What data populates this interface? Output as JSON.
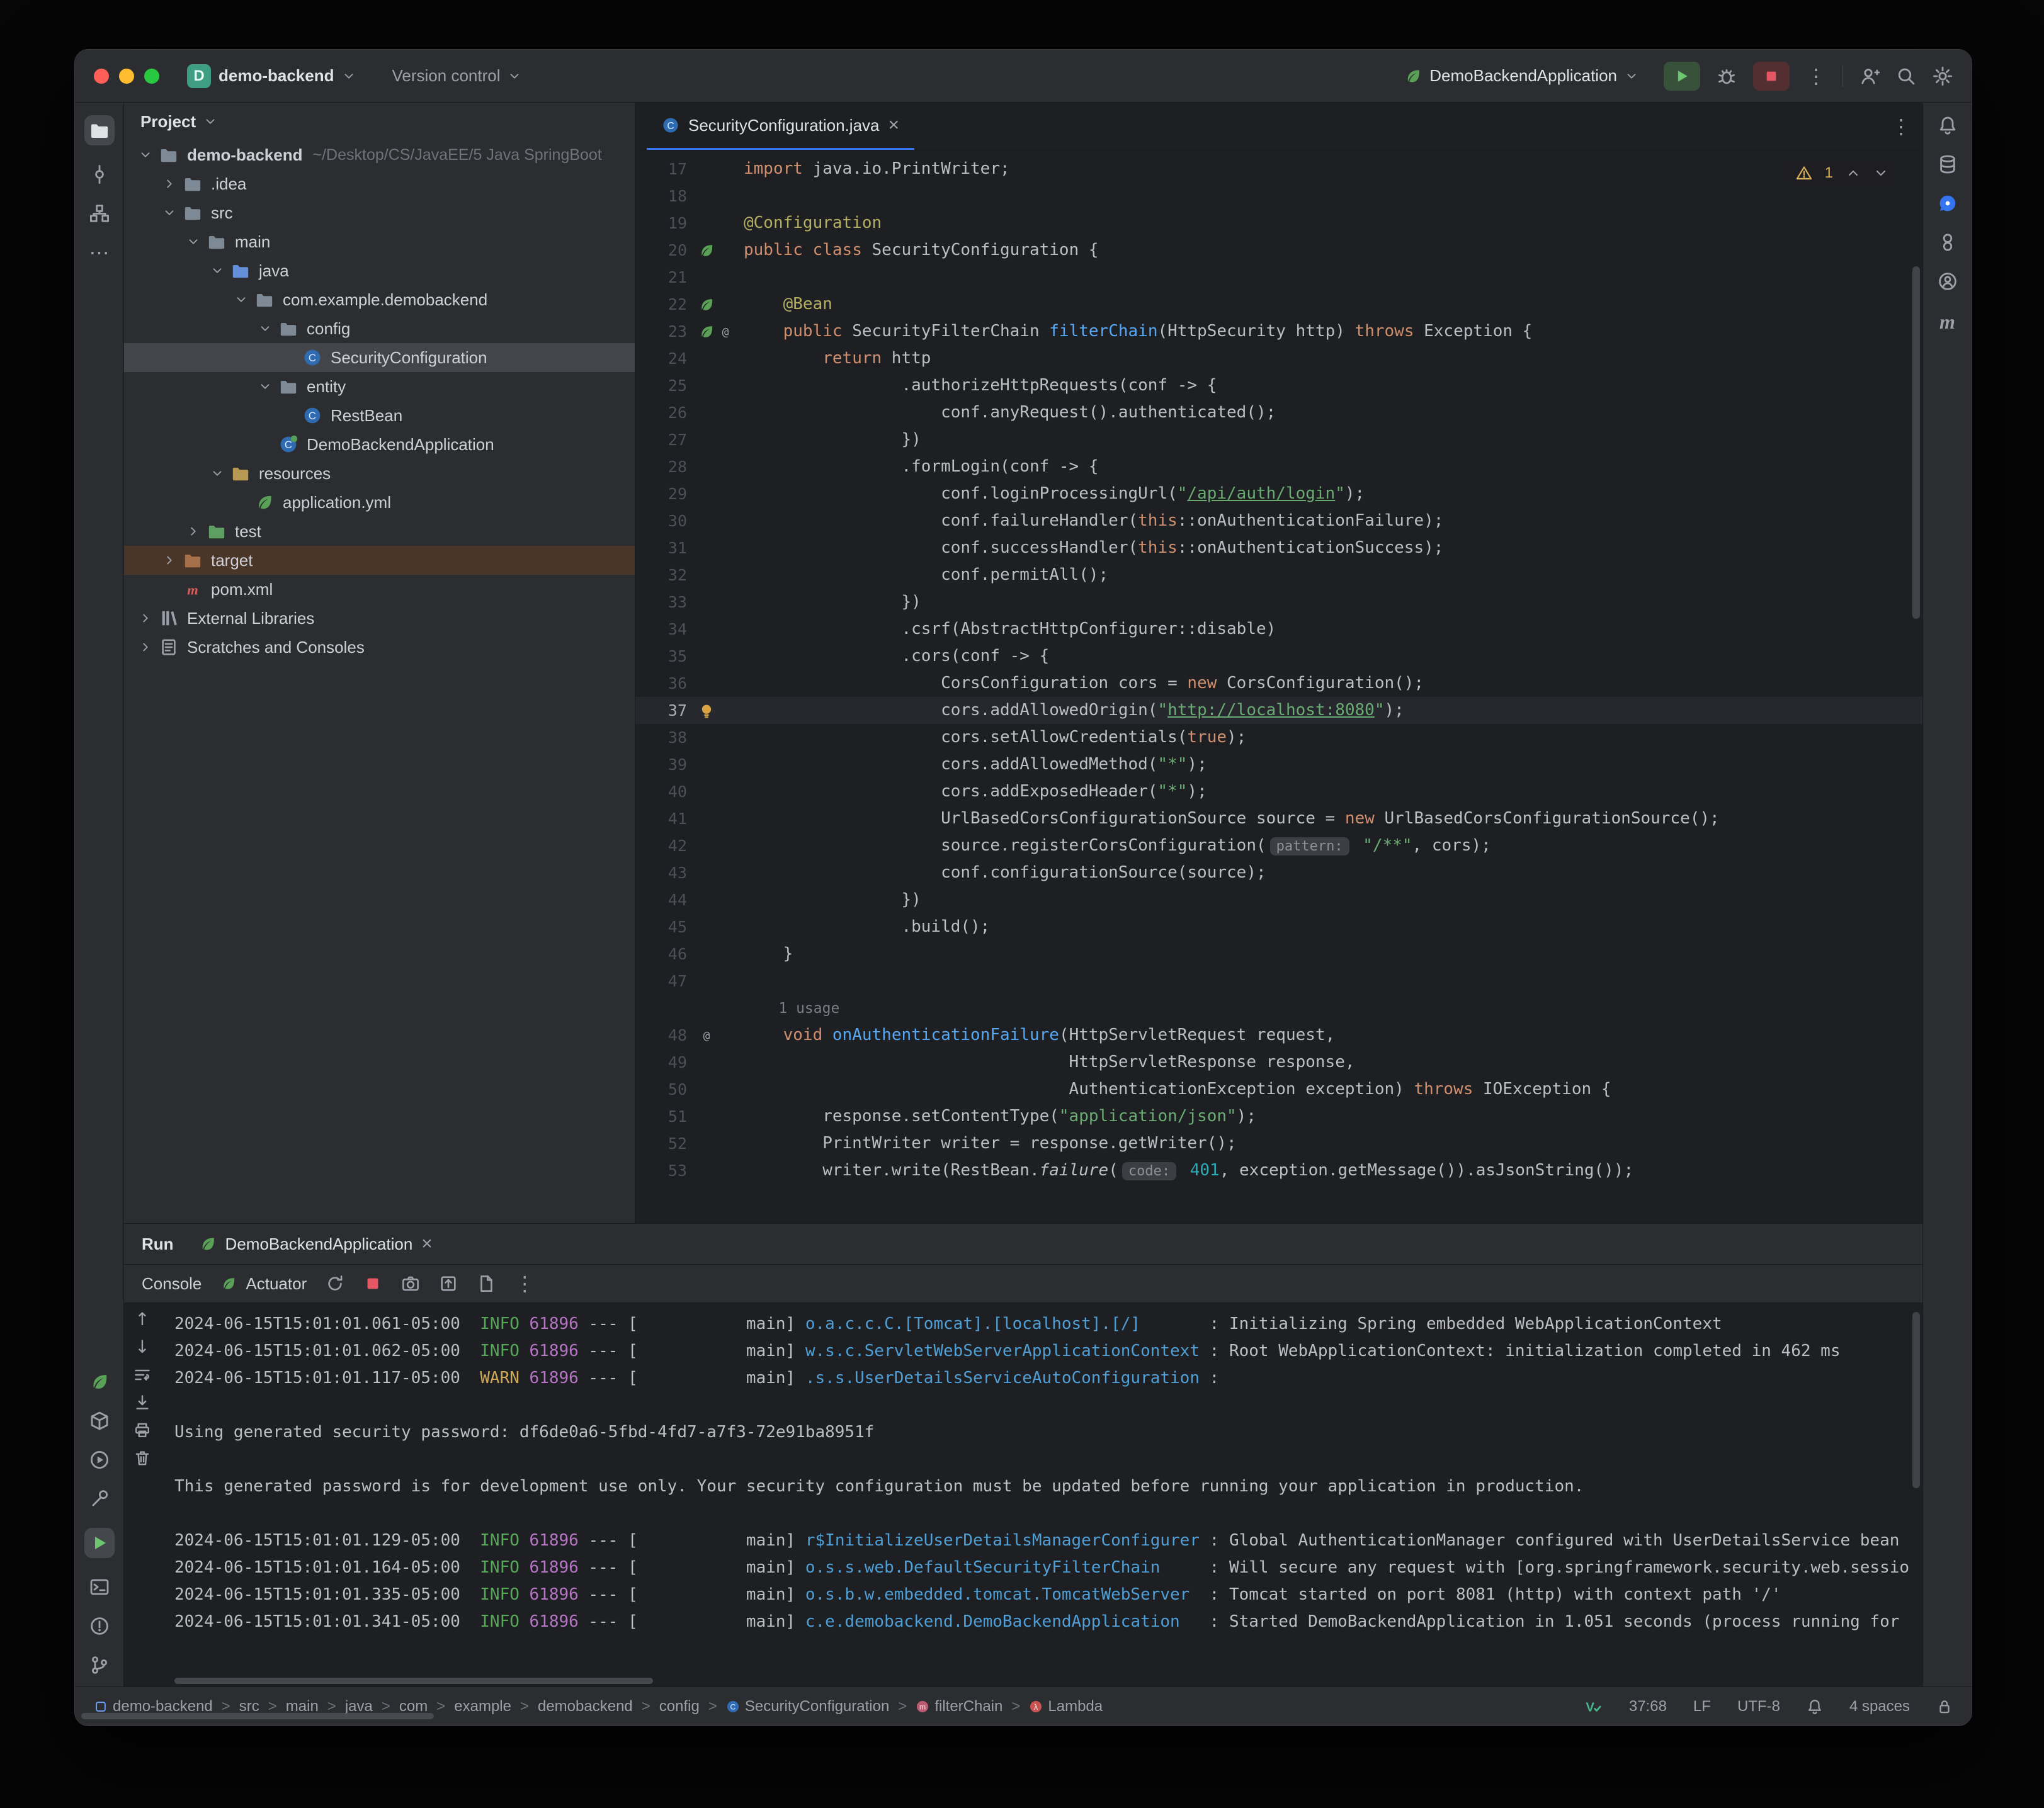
{
  "colors": {
    "accent": "#3574f0",
    "run_green": "#6cc56f",
    "stop_red": "#e55765",
    "warning": "#d6ae5a",
    "traffic_close": "#ff5f57",
    "traffic_min": "#febc2e",
    "traffic_zoom": "#28c840"
  },
  "title_bar": {
    "project_avatar": "D",
    "project_name": "demo-backend",
    "vcs_label": "Version control",
    "run_config": "DemoBackendApplication"
  },
  "left_strip": {
    "items": [
      "project",
      "commit",
      "structure",
      "more"
    ],
    "bottom_items": [
      "spring-boot",
      "services",
      "play-circle",
      "build",
      "run",
      "terminal",
      "problems",
      "git-branch"
    ]
  },
  "right_strip": {
    "items": [
      "notifications",
      "database",
      "ai-assistant",
      "beans",
      "profile",
      "maven"
    ]
  },
  "project_panel": {
    "header_label": "Project",
    "tree": [
      {
        "label": "demo-backend",
        "sub": "~/Desktop/CS/JavaEE/5 Java SpringBoot",
        "level": 0,
        "chev": "v",
        "icon": "folder",
        "bold": true
      },
      {
        "label": ".idea",
        "level": 1,
        "chev": ">",
        "icon": "folder"
      },
      {
        "label": "src",
        "level": 1,
        "chev": "v",
        "icon": "folder"
      },
      {
        "label": "main",
        "level": 2,
        "chev": "v",
        "icon": "folder"
      },
      {
        "label": "java",
        "level": 3,
        "chev": "v",
        "icon": "folder-src"
      },
      {
        "label": "com.example.demobackend",
        "level": 4,
        "chev": "v",
        "icon": "package"
      },
      {
        "label": "config",
        "level": 5,
        "chev": "v",
        "icon": "package"
      },
      {
        "label": "SecurityConfiguration",
        "level": 6,
        "icon": "class",
        "selected": true
      },
      {
        "label": "entity",
        "level": 5,
        "chev": "v",
        "icon": "package"
      },
      {
        "label": "RestBean",
        "level": 6,
        "icon": "class"
      },
      {
        "label": "DemoBackendApplication",
        "level": 5,
        "icon": "class-boot"
      },
      {
        "label": "resources",
        "level": 3,
        "chev": "v",
        "icon": "folder-res"
      },
      {
        "label": "application.yml",
        "level": 4,
        "icon": "spring-file"
      },
      {
        "label": "test",
        "level": 2,
        "chev": ">",
        "icon": "folder-test"
      },
      {
        "label": "target",
        "level": 1,
        "chev": ">",
        "icon": "folder-excl",
        "hl": true
      },
      {
        "label": "pom.xml",
        "level": 1,
        "icon": "maven"
      },
      {
        "label": "External Libraries",
        "level": 0,
        "chev": ">",
        "icon": "lib"
      },
      {
        "label": "Scratches and Consoles",
        "level": 0,
        "chev": ">",
        "icon": "scratch"
      }
    ]
  },
  "editor": {
    "tab_title": "SecurityConfiguration.java",
    "inspection": {
      "warning_count": "1"
    },
    "lines": [
      {
        "n": "17",
        "seg": [
          [
            "k",
            "import"
          ],
          [
            "d",
            " java.io.PrintWriter;"
          ]
        ]
      },
      {
        "n": "18",
        "seg": []
      },
      {
        "n": "19",
        "seg": [
          [
            "a",
            "@Configuration"
          ]
        ]
      },
      {
        "n": "20",
        "g": [
          "leaf"
        ],
        "seg": [
          [
            "k",
            "public"
          ],
          [
            "d",
            " "
          ],
          [
            "k",
            "class"
          ],
          [
            "d",
            " SecurityConfiguration {"
          ]
        ]
      },
      {
        "n": "21",
        "seg": []
      },
      {
        "n": "22",
        "g": [
          "leaf"
        ],
        "seg": [
          [
            "d",
            "    "
          ],
          [
            "a",
            "@Bean"
          ]
        ]
      },
      {
        "n": "23",
        "g": [
          "leaf",
          "at"
        ],
        "seg": [
          [
            "d",
            "    "
          ],
          [
            "k",
            "public"
          ],
          [
            "d",
            " SecurityFilterChain "
          ],
          [
            "m",
            "filterChain"
          ],
          [
            "d",
            "(HttpSecurity http) "
          ],
          [
            "k",
            "throws"
          ],
          [
            "d",
            " Exception {"
          ]
        ]
      },
      {
        "n": "24",
        "seg": [
          [
            "d",
            "        "
          ],
          [
            "k",
            "return"
          ],
          [
            "d",
            " http"
          ]
        ]
      },
      {
        "n": "25",
        "seg": [
          [
            "d",
            "                .authorizeHttpRequests(conf -> {"
          ]
        ]
      },
      {
        "n": "26",
        "seg": [
          [
            "d",
            "                    conf.anyRequest().authenticated();"
          ]
        ]
      },
      {
        "n": "27",
        "seg": [
          [
            "d",
            "                })"
          ]
        ]
      },
      {
        "n": "28",
        "seg": [
          [
            "d",
            "                .formLogin(conf -> {"
          ]
        ]
      },
      {
        "n": "29",
        "seg": [
          [
            "d",
            "                    conf.loginProcessingUrl("
          ],
          [
            "s",
            "\""
          ],
          [
            "su",
            "/api/auth/login"
          ],
          [
            "s",
            "\""
          ],
          [
            "d",
            ");"
          ]
        ]
      },
      {
        "n": "30",
        "seg": [
          [
            "d",
            "                    conf.failureHandler("
          ],
          [
            "k",
            "this"
          ],
          [
            "d",
            "::onAuthenticationFailure);"
          ]
        ]
      },
      {
        "n": "31",
        "seg": [
          [
            "d",
            "                    conf.successHandler("
          ],
          [
            "k",
            "this"
          ],
          [
            "d",
            "::onAuthenticationSuccess);"
          ]
        ]
      },
      {
        "n": "32",
        "seg": [
          [
            "d",
            "                    conf.permitAll();"
          ]
        ]
      },
      {
        "n": "33",
        "seg": [
          [
            "d",
            "                })"
          ]
        ]
      },
      {
        "n": "34",
        "seg": [
          [
            "d",
            "                .csrf(AbstractHttpConfigurer::disable)"
          ]
        ]
      },
      {
        "n": "35",
        "seg": [
          [
            "d",
            "                .cors(conf -> {"
          ]
        ]
      },
      {
        "n": "36",
        "seg": [
          [
            "d",
            "                    CorsConfiguration cors = "
          ],
          [
            "k",
            "new"
          ],
          [
            "d",
            " CorsConfiguration();"
          ]
        ]
      },
      {
        "n": "37",
        "cur": true,
        "g": [
          "bulb"
        ],
        "seg": [
          [
            "d",
            "                    cors.addAllowedOrigin("
          ],
          [
            "s",
            "\""
          ],
          [
            "su",
            "http://localhost:8080"
          ],
          [
            "s",
            "\""
          ],
          [
            "d",
            ");"
          ]
        ]
      },
      {
        "n": "38",
        "seg": [
          [
            "d",
            "                    cors.setAllowCredentials("
          ],
          [
            "k",
            "true"
          ],
          [
            "d",
            ");"
          ]
        ]
      },
      {
        "n": "39",
        "seg": [
          [
            "d",
            "                    cors.addAllowedMethod("
          ],
          [
            "s",
            "\"*\""
          ],
          [
            "d",
            ");"
          ]
        ]
      },
      {
        "n": "40",
        "seg": [
          [
            "d",
            "                    cors.addExposedHeader("
          ],
          [
            "s",
            "\"*\""
          ],
          [
            "d",
            ");"
          ]
        ]
      },
      {
        "n": "41",
        "seg": [
          [
            "d",
            "                    UrlBasedCorsConfigurationSource source = "
          ],
          [
            "k",
            "new"
          ],
          [
            "d",
            " UrlBasedCorsConfigurationSource();"
          ]
        ]
      },
      {
        "n": "42",
        "seg": [
          [
            "d",
            "                    source.registerCorsConfiguration("
          ],
          [
            "i",
            "pattern:"
          ],
          [
            "d",
            " "
          ],
          [
            "s",
            "\"/**\""
          ],
          [
            "d",
            ", cors);"
          ]
        ]
      },
      {
        "n": "43",
        "seg": [
          [
            "d",
            "                    conf.configurationSource(source);"
          ]
        ]
      },
      {
        "n": "44",
        "seg": [
          [
            "d",
            "                })"
          ]
        ]
      },
      {
        "n": "45",
        "seg": [
          [
            "d",
            "                .build();"
          ]
        ]
      },
      {
        "n": "46",
        "seg": [
          [
            "d",
            "    }"
          ]
        ]
      },
      {
        "n": "47",
        "seg": []
      },
      {
        "n": "",
        "usage": true,
        "seg": [
          [
            "g",
            "    1 usage"
          ]
        ]
      },
      {
        "n": "48",
        "g": [
          "at"
        ],
        "seg": [
          [
            "d",
            "    "
          ],
          [
            "k",
            "void"
          ],
          [
            "d",
            " "
          ],
          [
            "m",
            "onAuthenticationFailure"
          ],
          [
            "d",
            "(HttpServletRequest request,"
          ]
        ]
      },
      {
        "n": "49",
        "seg": [
          [
            "d",
            "                                 HttpServletResponse response,"
          ]
        ]
      },
      {
        "n": "50",
        "seg": [
          [
            "d",
            "                                 AuthenticationException exception) "
          ],
          [
            "k",
            "throws"
          ],
          [
            "d",
            " IOException {"
          ]
        ]
      },
      {
        "n": "51",
        "seg": [
          [
            "d",
            "        response.setContentType("
          ],
          [
            "s",
            "\"application/json\""
          ],
          [
            "d",
            ");"
          ]
        ]
      },
      {
        "n": "52",
        "seg": [
          [
            "d",
            "        PrintWriter writer = response.getWriter();"
          ]
        ]
      },
      {
        "n": "53",
        "seg": [
          [
            "d",
            "        writer.write(RestBean."
          ],
          [
            "it",
            "failure"
          ],
          [
            "d",
            "("
          ],
          [
            "i",
            "code:"
          ],
          [
            "d",
            " "
          ],
          [
            "n2",
            "401"
          ],
          [
            "d",
            ", exception.getMessage()).asJsonString());"
          ]
        ]
      }
    ]
  },
  "run_panel": {
    "tool_label": "Run",
    "tab_label": "DemoBackendApplication",
    "console_label": "Console",
    "actuator_label": "Actuator",
    "console": {
      "lines": [
        {
          "seg": [
            [
              "t",
              "2024-06-15T15:01:01.061-05:00  "
            ],
            [
              "i",
              "INFO"
            ],
            [
              "t",
              " "
            ],
            [
              "p",
              "61896"
            ],
            [
              "t",
              " --- [           main] "
            ],
            [
              "l",
              "o.a.c.c.C.[Tomcat].[localhost].[/]      "
            ],
            [
              "t",
              " : Initializing Spring embedded WebApplicationContext"
            ]
          ]
        },
        {
          "seg": [
            [
              "t",
              "2024-06-15T15:01:01.062-05:00  "
            ],
            [
              "i",
              "INFO"
            ],
            [
              "t",
              " "
            ],
            [
              "p",
              "61896"
            ],
            [
              "t",
              " --- [           main] "
            ],
            [
              "l",
              "w.s.c.ServletWebServerApplicationContext"
            ],
            [
              "t",
              " : Root WebApplicationContext: initialization completed in 462 ms"
            ]
          ]
        },
        {
          "seg": [
            [
              "t",
              "2024-06-15T15:01:01.117-05:00  "
            ],
            [
              "w",
              "WARN"
            ],
            [
              "t",
              " "
            ],
            [
              "p",
              "61896"
            ],
            [
              "t",
              " --- [           main] "
            ],
            [
              "l",
              ".s.s.UserDetailsServiceAutoConfiguration"
            ],
            [
              "t",
              " : "
            ]
          ]
        },
        {
          "seg": []
        },
        {
          "seg": [
            [
              "t",
              "Using generated security password: df6de0a6-5fbd-4fd7-a7f3-72e91ba8951f"
            ]
          ]
        },
        {
          "seg": []
        },
        {
          "seg": [
            [
              "t",
              "This generated password is for development use only. Your security configuration must be updated before running your application in production."
            ]
          ]
        },
        {
          "seg": []
        },
        {
          "seg": [
            [
              "t",
              "2024-06-15T15:01:01.129-05:00  "
            ],
            [
              "i",
              "INFO"
            ],
            [
              "t",
              " "
            ],
            [
              "p",
              "61896"
            ],
            [
              "t",
              " --- [           main] "
            ],
            [
              "l",
              "r$InitializeUserDetailsManagerConfigurer"
            ],
            [
              "t",
              " : Global AuthenticationManager configured with UserDetailsService bean"
            ]
          ]
        },
        {
          "seg": [
            [
              "t",
              "2024-06-15T15:01:01.164-05:00  "
            ],
            [
              "i",
              "INFO"
            ],
            [
              "t",
              " "
            ],
            [
              "p",
              "61896"
            ],
            [
              "t",
              " --- [           main] "
            ],
            [
              "l",
              "o.s.s.web.DefaultSecurityFilterChain    "
            ],
            [
              "t",
              " : Will secure any request with [org.springframework.security.web.sessio"
            ]
          ]
        },
        {
          "seg": [
            [
              "t",
              "2024-06-15T15:01:01.335-05:00  "
            ],
            [
              "i",
              "INFO"
            ],
            [
              "t",
              " "
            ],
            [
              "p",
              "61896"
            ],
            [
              "t",
              " --- [           main] "
            ],
            [
              "l",
              "o.s.b.w.embedded.tomcat.TomcatWebServer "
            ],
            [
              "t",
              " : Tomcat started on port 8081 (http) with context path '/'"
            ]
          ]
        },
        {
          "seg": [
            [
              "t",
              "2024-06-15T15:01:01.341-05:00  "
            ],
            [
              "i",
              "INFO"
            ],
            [
              "t",
              " "
            ],
            [
              "p",
              "61896"
            ],
            [
              "t",
              " --- [           main] "
            ],
            [
              "l",
              "c.e.demobackend.DemoBackendApplication  "
            ],
            [
              "t",
              " : Started DemoBackendApplication in 1.051 seconds (process running for"
            ]
          ]
        }
      ]
    }
  },
  "status_bar": {
    "separator": ">",
    "breadcrumbs": [
      {
        "label": "demo-backend",
        "icon": "module"
      },
      {
        "label": "src"
      },
      {
        "label": "main"
      },
      {
        "label": "java"
      },
      {
        "label": "com"
      },
      {
        "label": "example"
      },
      {
        "label": "demobackend"
      },
      {
        "label": "config"
      },
      {
        "label": "SecurityConfiguration",
        "icon": "crumb-class"
      },
      {
        "label": "filterChain",
        "icon": "crumb-method"
      },
      {
        "label": "Lambda",
        "icon": "crumb-lambda"
      }
    ],
    "right": {
      "caret": "37:68",
      "line_sep": "LF",
      "encoding": "UTF-8",
      "indent": "4 spaces"
    }
  }
}
